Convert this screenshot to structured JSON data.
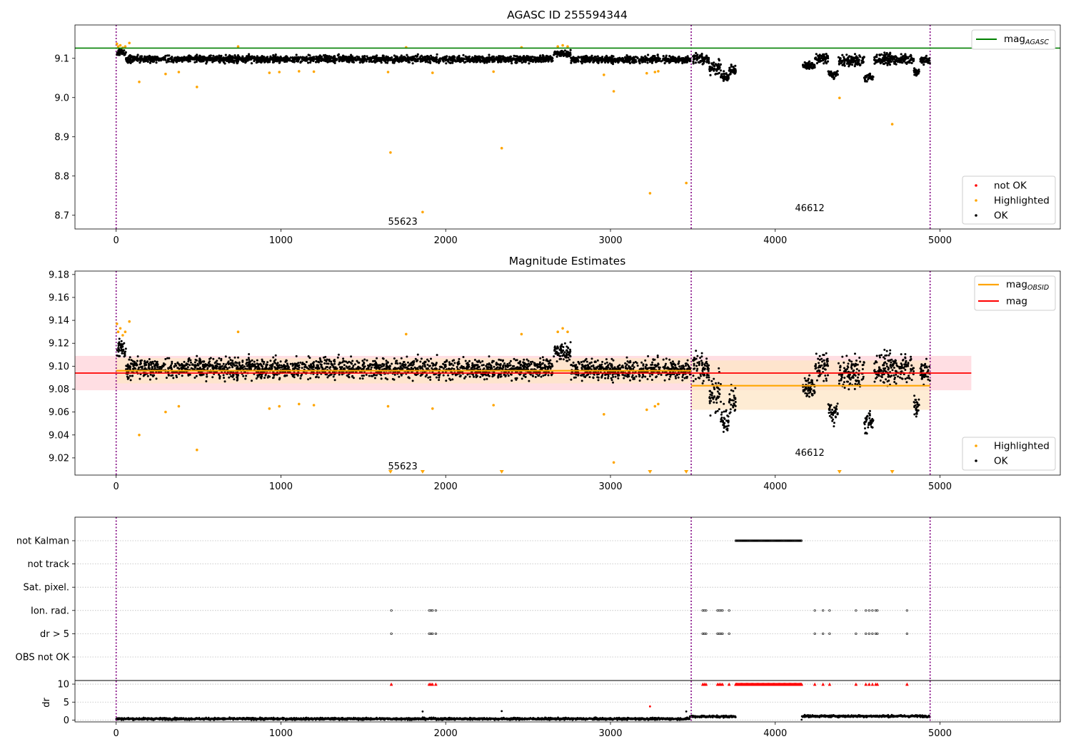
{
  "colors": {
    "ok": "#000000",
    "highlighted": "#ffa500",
    "not_ok": "#ff0000",
    "agasc_line": "#008000",
    "obsid_line": "#ffa500",
    "mag_line": "#ff0000",
    "vline": "#800080",
    "mag_band": "#ffb6c1",
    "obsid_band": "#fde6c6"
  },
  "chart_data": [
    {
      "type": "scatter",
      "title": "AGASC ID 255594344",
      "xlim": [
        -250,
        5730
      ],
      "ylim": [
        8.665,
        9.185
      ],
      "xticks": [
        0,
        1000,
        2000,
        3000,
        4000,
        5000
      ],
      "xtick_labels": [
        "0",
        "1000",
        "2000",
        "3000",
        "4000",
        "5000"
      ],
      "yticks": [
        8.7,
        8.8,
        8.9,
        9.0,
        9.1
      ],
      "ytick_labels": [
        "8.7",
        "8.8",
        "8.9",
        "9.0",
        "9.1"
      ],
      "vlines": [
        0,
        3490,
        4940
      ],
      "hline_mag_agasc": 9.126,
      "obsid_labels": [
        {
          "text": "55623",
          "x": 1650,
          "y": 8.685
        },
        {
          "text": "46612",
          "x": 4120,
          "y": 8.72
        }
      ],
      "legend_upper": {
        "position": "upper right",
        "entries": [
          {
            "label": "mag",
            "sub": "AGASC"
          }
        ]
      },
      "legend_lower": {
        "position": "lower right",
        "entries": [
          {
            "label": "not OK",
            "kind": "not_ok"
          },
          {
            "label": "Highlighted",
            "kind": "highlighted"
          },
          {
            "label": "OK",
            "kind": "ok"
          }
        ]
      },
      "series": [
        {
          "name": "OK",
          "segments": [
            {
              "x0": 0,
              "x1": 60,
              "base": 9.115,
              "amp": 0.01
            },
            {
              "x0": 60,
              "x1": 2650,
              "base": 9.098,
              "amp": 0.011
            },
            {
              "x0": 2650,
              "x1": 2760,
              "base": 9.112,
              "amp": 0.01
            },
            {
              "x0": 2760,
              "x1": 3490,
              "base": 9.097,
              "amp": 0.011
            },
            {
              "x0": 3500,
              "x1": 3600,
              "base": 9.098,
              "amp": 0.016
            },
            {
              "x0": 3600,
              "x1": 3670,
              "base": 9.075,
              "amp": 0.022
            },
            {
              "x0": 3670,
              "x1": 3720,
              "base": 9.052,
              "amp": 0.013
            },
            {
              "x0": 3720,
              "x1": 3760,
              "base": 9.07,
              "amp": 0.016
            },
            {
              "x0": 4160,
              "x1": 4240,
              "base": 9.082,
              "amp": 0.012
            },
            {
              "x0": 4240,
              "x1": 4320,
              "base": 9.1,
              "amp": 0.014
            },
            {
              "x0": 4320,
              "x1": 4380,
              "base": 9.06,
              "amp": 0.012
            },
            {
              "x0": 4380,
              "x1": 4540,
              "base": 9.095,
              "amp": 0.018
            },
            {
              "x0": 4540,
              "x1": 4600,
              "base": 9.05,
              "amp": 0.013
            },
            {
              "x0": 4600,
              "x1": 4840,
              "base": 9.098,
              "amp": 0.017
            },
            {
              "x0": 4840,
              "x1": 4880,
              "base": 9.065,
              "amp": 0.012
            },
            {
              "x0": 4880,
              "x1": 4940,
              "base": 9.095,
              "amp": 0.014
            }
          ]
        },
        {
          "name": "Highlighted",
          "points": [
            [
              5,
              9.137
            ],
            [
              12,
              9.13
            ],
            [
              25,
              9.133
            ],
            [
              40,
              9.127
            ],
            [
              55,
              9.13
            ],
            [
              80,
              9.139
            ],
            [
              140,
              9.04
            ],
            [
              300,
              9.06
            ],
            [
              380,
              9.065
            ],
            [
              490,
              9.027
            ],
            [
              740,
              9.13
            ],
            [
              930,
              9.063
            ],
            [
              990,
              9.065
            ],
            [
              1110,
              9.067
            ],
            [
              1200,
              9.066
            ],
            [
              1650,
              9.065
            ],
            [
              1665,
              8.86
            ],
            [
              1760,
              9.128
            ],
            [
              1860,
              8.708
            ],
            [
              1920,
              9.063
            ],
            [
              2290,
              9.066
            ],
            [
              2340,
              8.871
            ],
            [
              2460,
              9.128
            ],
            [
              2680,
              9.13
            ],
            [
              2710,
              9.133
            ],
            [
              2740,
              9.13
            ],
            [
              2960,
              9.058
            ],
            [
              3020,
              9.016
            ],
            [
              3220,
              9.062
            ],
            [
              3240,
              8.756
            ],
            [
              3270,
              9.065
            ],
            [
              3290,
              9.067
            ],
            [
              3460,
              8.782
            ],
            [
              4390,
              8.999
            ],
            [
              4710,
              8.932
            ]
          ]
        }
      ]
    },
    {
      "type": "scatter",
      "title": "Magnitude Estimates",
      "xlim": [
        -250,
        5730
      ],
      "ylim": [
        9.005,
        9.183
      ],
      "xticks": [
        0,
        1000,
        2000,
        3000,
        4000,
        5000
      ],
      "xtick_labels": [
        "0",
        "1000",
        "2000",
        "3000",
        "4000",
        "5000"
      ],
      "yticks": [
        9.02,
        9.04,
        9.06,
        9.08,
        9.1,
        9.12,
        9.14,
        9.16,
        9.18
      ],
      "ytick_labels": [
        "9.02",
        "9.04",
        "9.06",
        "9.08",
        "9.10",
        "9.12",
        "9.14",
        "9.16",
        "9.18"
      ],
      "vlines": [
        0,
        3490,
        4940
      ],
      "mag": {
        "value": 9.094,
        "band": [
          9.079,
          9.109
        ],
        "x": [
          -250,
          5190
        ]
      },
      "mag_obsid": [
        {
          "x": [
            0,
            3490
          ],
          "value": 9.096,
          "band": [
            9.085,
            9.107
          ]
        },
        {
          "x": [
            3490,
            4940
          ],
          "value": 9.083,
          "band": [
            9.062,
            9.105
          ]
        }
      ],
      "obsid_labels": [
        {
          "text": "55623",
          "x": 1650,
          "y": 9.013
        },
        {
          "text": "46612",
          "x": 4120,
          "y": 9.025
        }
      ],
      "out_of_range_x": [
        1665,
        1860,
        2340,
        3240,
        3460,
        4390,
        4710
      ],
      "legend_upper": {
        "position": "upper right",
        "entries": [
          {
            "label": "mag",
            "sub": "OBSID",
            "kind": "obsid"
          },
          {
            "label": "mag",
            "kind": "mag"
          }
        ]
      },
      "legend_lower": {
        "position": "lower right",
        "entries": [
          {
            "label": "Highlighted",
            "kind": "highlighted"
          },
          {
            "label": "OK",
            "kind": "ok"
          }
        ]
      }
    },
    {
      "type": "scatter",
      "flag_rows": [
        "not Kalman",
        "not track",
        "Sat. pixel.",
        "Ion. rad.",
        "dr > 5",
        "OBS not OK"
      ],
      "flags": {
        "not Kalman": [
          [
            3760,
            4160
          ]
        ],
        "Ion. rad.": [
          1670,
          1900,
          1910,
          1920,
          1940,
          3560,
          3570,
          3580,
          3650,
          3660,
          3670,
          3680,
          3720,
          4240,
          4290,
          4330,
          4490,
          4550,
          4570,
          4590,
          4610,
          4620,
          4800
        ],
        "dr > 5": [
          1670,
          1900,
          1910,
          1920,
          1940,
          3560,
          3570,
          3580,
          3650,
          3660,
          3670,
          3680,
          3720,
          4240,
          4290,
          4330,
          4490,
          4550,
          4570,
          4590,
          4610,
          4620,
          4800
        ]
      },
      "xlim": [
        -250,
        5730
      ],
      "xticks": [
        0,
        1000,
        2000,
        3000,
        4000,
        5000
      ],
      "xtick_labels": [
        "0",
        "1000",
        "2000",
        "3000",
        "4000",
        "5000"
      ],
      "vlines": [
        0,
        3490,
        4940
      ],
      "dr": {
        "ylabel": "dr",
        "ylim": [
          -0.5,
          11
        ],
        "yticks": [
          0,
          5,
          10
        ],
        "ytick_labels": [
          "0",
          "5",
          "10"
        ],
        "capped_value": 10,
        "capped_x": [
          1670,
          1900,
          1910,
          1920,
          1940,
          3560,
          3570,
          3580,
          3650,
          3660,
          3670,
          3680,
          3720,
          4240,
          4290,
          4330,
          4490,
          4550,
          4570,
          4590,
          4610,
          4620,
          4800
        ],
        "capped_range": [
          3760,
          4160
        ],
        "outliers": [
          [
            1860,
            2.4
          ],
          [
            2340,
            2.5
          ],
          [
            3240,
            3.8
          ],
          [
            3460,
            2.4
          ]
        ]
      }
    }
  ]
}
